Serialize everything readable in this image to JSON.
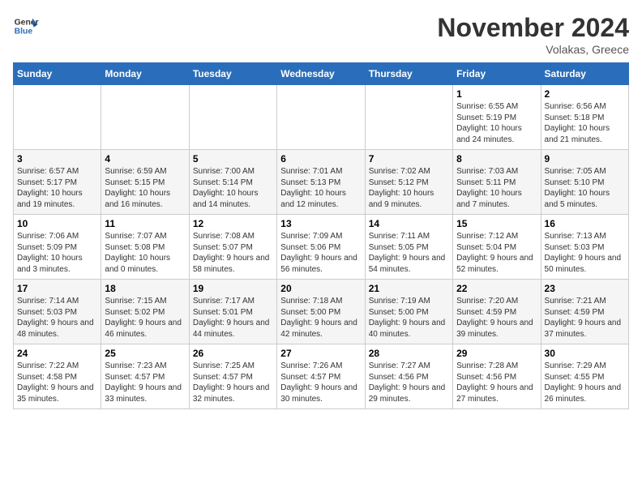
{
  "header": {
    "logo_line1": "General",
    "logo_line2": "Blue",
    "month": "November 2024",
    "location": "Volakas, Greece"
  },
  "weekdays": [
    "Sunday",
    "Monday",
    "Tuesday",
    "Wednesday",
    "Thursday",
    "Friday",
    "Saturday"
  ],
  "weeks": [
    [
      {
        "day": "",
        "info": ""
      },
      {
        "day": "",
        "info": ""
      },
      {
        "day": "",
        "info": ""
      },
      {
        "day": "",
        "info": ""
      },
      {
        "day": "",
        "info": ""
      },
      {
        "day": "1",
        "info": "Sunrise: 6:55 AM\nSunset: 5:19 PM\nDaylight: 10 hours and 24 minutes."
      },
      {
        "day": "2",
        "info": "Sunrise: 6:56 AM\nSunset: 5:18 PM\nDaylight: 10 hours and 21 minutes."
      }
    ],
    [
      {
        "day": "3",
        "info": "Sunrise: 6:57 AM\nSunset: 5:17 PM\nDaylight: 10 hours and 19 minutes."
      },
      {
        "day": "4",
        "info": "Sunrise: 6:59 AM\nSunset: 5:15 PM\nDaylight: 10 hours and 16 minutes."
      },
      {
        "day": "5",
        "info": "Sunrise: 7:00 AM\nSunset: 5:14 PM\nDaylight: 10 hours and 14 minutes."
      },
      {
        "day": "6",
        "info": "Sunrise: 7:01 AM\nSunset: 5:13 PM\nDaylight: 10 hours and 12 minutes."
      },
      {
        "day": "7",
        "info": "Sunrise: 7:02 AM\nSunset: 5:12 PM\nDaylight: 10 hours and 9 minutes."
      },
      {
        "day": "8",
        "info": "Sunrise: 7:03 AM\nSunset: 5:11 PM\nDaylight: 10 hours and 7 minutes."
      },
      {
        "day": "9",
        "info": "Sunrise: 7:05 AM\nSunset: 5:10 PM\nDaylight: 10 hours and 5 minutes."
      }
    ],
    [
      {
        "day": "10",
        "info": "Sunrise: 7:06 AM\nSunset: 5:09 PM\nDaylight: 10 hours and 3 minutes."
      },
      {
        "day": "11",
        "info": "Sunrise: 7:07 AM\nSunset: 5:08 PM\nDaylight: 10 hours and 0 minutes."
      },
      {
        "day": "12",
        "info": "Sunrise: 7:08 AM\nSunset: 5:07 PM\nDaylight: 9 hours and 58 minutes."
      },
      {
        "day": "13",
        "info": "Sunrise: 7:09 AM\nSunset: 5:06 PM\nDaylight: 9 hours and 56 minutes."
      },
      {
        "day": "14",
        "info": "Sunrise: 7:11 AM\nSunset: 5:05 PM\nDaylight: 9 hours and 54 minutes."
      },
      {
        "day": "15",
        "info": "Sunrise: 7:12 AM\nSunset: 5:04 PM\nDaylight: 9 hours and 52 minutes."
      },
      {
        "day": "16",
        "info": "Sunrise: 7:13 AM\nSunset: 5:03 PM\nDaylight: 9 hours and 50 minutes."
      }
    ],
    [
      {
        "day": "17",
        "info": "Sunrise: 7:14 AM\nSunset: 5:03 PM\nDaylight: 9 hours and 48 minutes."
      },
      {
        "day": "18",
        "info": "Sunrise: 7:15 AM\nSunset: 5:02 PM\nDaylight: 9 hours and 46 minutes."
      },
      {
        "day": "19",
        "info": "Sunrise: 7:17 AM\nSunset: 5:01 PM\nDaylight: 9 hours and 44 minutes."
      },
      {
        "day": "20",
        "info": "Sunrise: 7:18 AM\nSunset: 5:00 PM\nDaylight: 9 hours and 42 minutes."
      },
      {
        "day": "21",
        "info": "Sunrise: 7:19 AM\nSunset: 5:00 PM\nDaylight: 9 hours and 40 minutes."
      },
      {
        "day": "22",
        "info": "Sunrise: 7:20 AM\nSunset: 4:59 PM\nDaylight: 9 hours and 39 minutes."
      },
      {
        "day": "23",
        "info": "Sunrise: 7:21 AM\nSunset: 4:59 PM\nDaylight: 9 hours and 37 minutes."
      }
    ],
    [
      {
        "day": "24",
        "info": "Sunrise: 7:22 AM\nSunset: 4:58 PM\nDaylight: 9 hours and 35 minutes."
      },
      {
        "day": "25",
        "info": "Sunrise: 7:23 AM\nSunset: 4:57 PM\nDaylight: 9 hours and 33 minutes."
      },
      {
        "day": "26",
        "info": "Sunrise: 7:25 AM\nSunset: 4:57 PM\nDaylight: 9 hours and 32 minutes."
      },
      {
        "day": "27",
        "info": "Sunrise: 7:26 AM\nSunset: 4:57 PM\nDaylight: 9 hours and 30 minutes."
      },
      {
        "day": "28",
        "info": "Sunrise: 7:27 AM\nSunset: 4:56 PM\nDaylight: 9 hours and 29 minutes."
      },
      {
        "day": "29",
        "info": "Sunrise: 7:28 AM\nSunset: 4:56 PM\nDaylight: 9 hours and 27 minutes."
      },
      {
        "day": "30",
        "info": "Sunrise: 7:29 AM\nSunset: 4:55 PM\nDaylight: 9 hours and 26 minutes."
      }
    ]
  ]
}
